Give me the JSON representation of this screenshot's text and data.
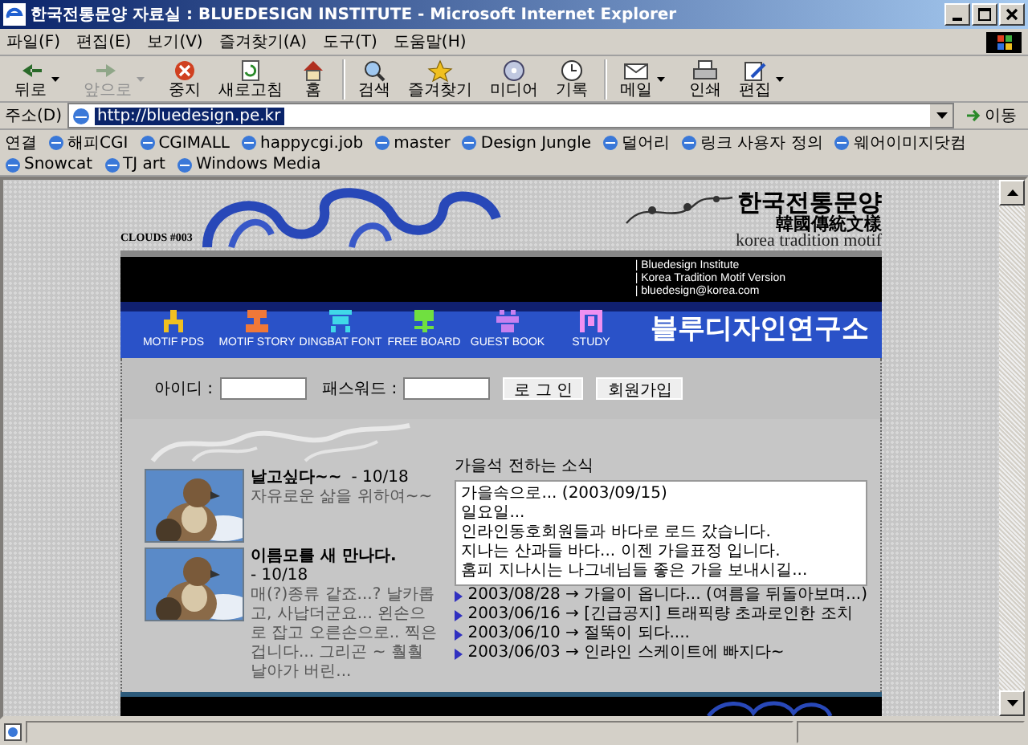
{
  "window": {
    "title": "한국전통문양 자료실 : BLUEDESIGN INSTITUTE - Microsoft Internet Explorer"
  },
  "menu": [
    "파일(F)",
    "편집(E)",
    "보기(V)",
    "즐겨찾기(A)",
    "도구(T)",
    "도움말(H)"
  ],
  "toolbar": [
    {
      "label": "뒤로",
      "disabled": false,
      "has_menu": true,
      "separator_before": false
    },
    {
      "label": "앞으로",
      "disabled": true,
      "has_menu": true,
      "separator_before": false
    },
    {
      "label": "중지",
      "disabled": false,
      "has_menu": false,
      "separator_before": false
    },
    {
      "label": "새로고침",
      "disabled": false,
      "has_menu": false,
      "separator_before": false
    },
    {
      "label": "홈",
      "disabled": false,
      "has_menu": false,
      "separator_before": false
    },
    {
      "label": "검색",
      "disabled": false,
      "has_menu": false,
      "separator_before": true
    },
    {
      "label": "즐겨찾기",
      "disabled": false,
      "has_menu": false,
      "separator_before": false
    },
    {
      "label": "미디어",
      "disabled": false,
      "has_menu": false,
      "separator_before": false
    },
    {
      "label": "기록",
      "disabled": false,
      "has_menu": false,
      "separator_before": false
    },
    {
      "label": "메일",
      "disabled": false,
      "has_menu": true,
      "separator_before": true
    },
    {
      "label": "인쇄",
      "disabled": false,
      "has_menu": false,
      "separator_before": false
    },
    {
      "label": "편집",
      "disabled": false,
      "has_menu": true,
      "separator_before": false
    }
  ],
  "address": {
    "label": "주소(D)",
    "value": "http://bluedesign.pe.kr",
    "highlighted": true,
    "go": "이동"
  },
  "links": {
    "label": "연결",
    "items": [
      "해피CGI",
      "CGIMALL",
      "happycgi.job",
      "master",
      "Design Jungle",
      "덜어리",
      "링크 사용자 정의",
      "웨어이미지닷컴",
      "Snowcat",
      "TJ art",
      "Windows Media"
    ]
  },
  "page": {
    "badge": "CLOUDS #003",
    "logo": {
      "title": "한국전통문양",
      "hanja": "韓國傳統文樣",
      "subtitle": "korea tradition motif"
    },
    "info": [
      "| Bluedesign Institute",
      "| Korea Tradition Motif Version",
      "| bluedesign@korea.com"
    ],
    "nav": [
      {
        "label": "MOTIF PDS",
        "color": "#f0c020"
      },
      {
        "label": "MOTIF STORY",
        "color": "#f07838"
      },
      {
        "label": "DINGBAT FONT",
        "color": "#40d8e8"
      },
      {
        "label": "FREE BOARD",
        "color": "#70e040"
      },
      {
        "label": "GUEST BOOK",
        "color": "#c880f0"
      },
      {
        "label": "STUDY",
        "color": "#f090f0"
      }
    ],
    "site_name": "블루디자인연구소",
    "login": {
      "id_label": "아이디 :",
      "password_label": "패스워드 :",
      "login_button": "로 그 인",
      "join_button": "회원가입"
    },
    "posts": [
      {
        "title": "날고싶다~~",
        "date": "- 10/18",
        "text": "자유로운 삶을 위하여~~"
      },
      {
        "title": "이름모를 새 만나다.",
        "date": "- 10/18",
        "text": "매(?)종류 같죠...? 날카롭고, 사납더군요... 왼손으로 잡고 오른손으로.. 찍은겁니다... 그리곤 ~ 훨훨 날아가 버린..."
      }
    ],
    "news": {
      "title": "가을석 전하는 소식",
      "box_lines": [
        "가을속으로... (2003/09/15)",
        "일요일...",
        "인라인동호회원들과 바다로 로드 갔습니다.",
        "지나는 산과들 바다... 이젠 가을표정 입니다.",
        "홈피 지나시는 나그네님들 좋은 가을 보내시길..."
      ],
      "items": [
        "2003/08/28 → 가을이 옵니다... (여름을 뒤돌아보며...)",
        "2003/06/16 → [긴급공지] 트래픽량 초과로인한 조치",
        "2003/06/10 → 절뚝이 되다....",
        "2003/06/03 → 인라인 스케이트에 빠지다~"
      ]
    }
  }
}
